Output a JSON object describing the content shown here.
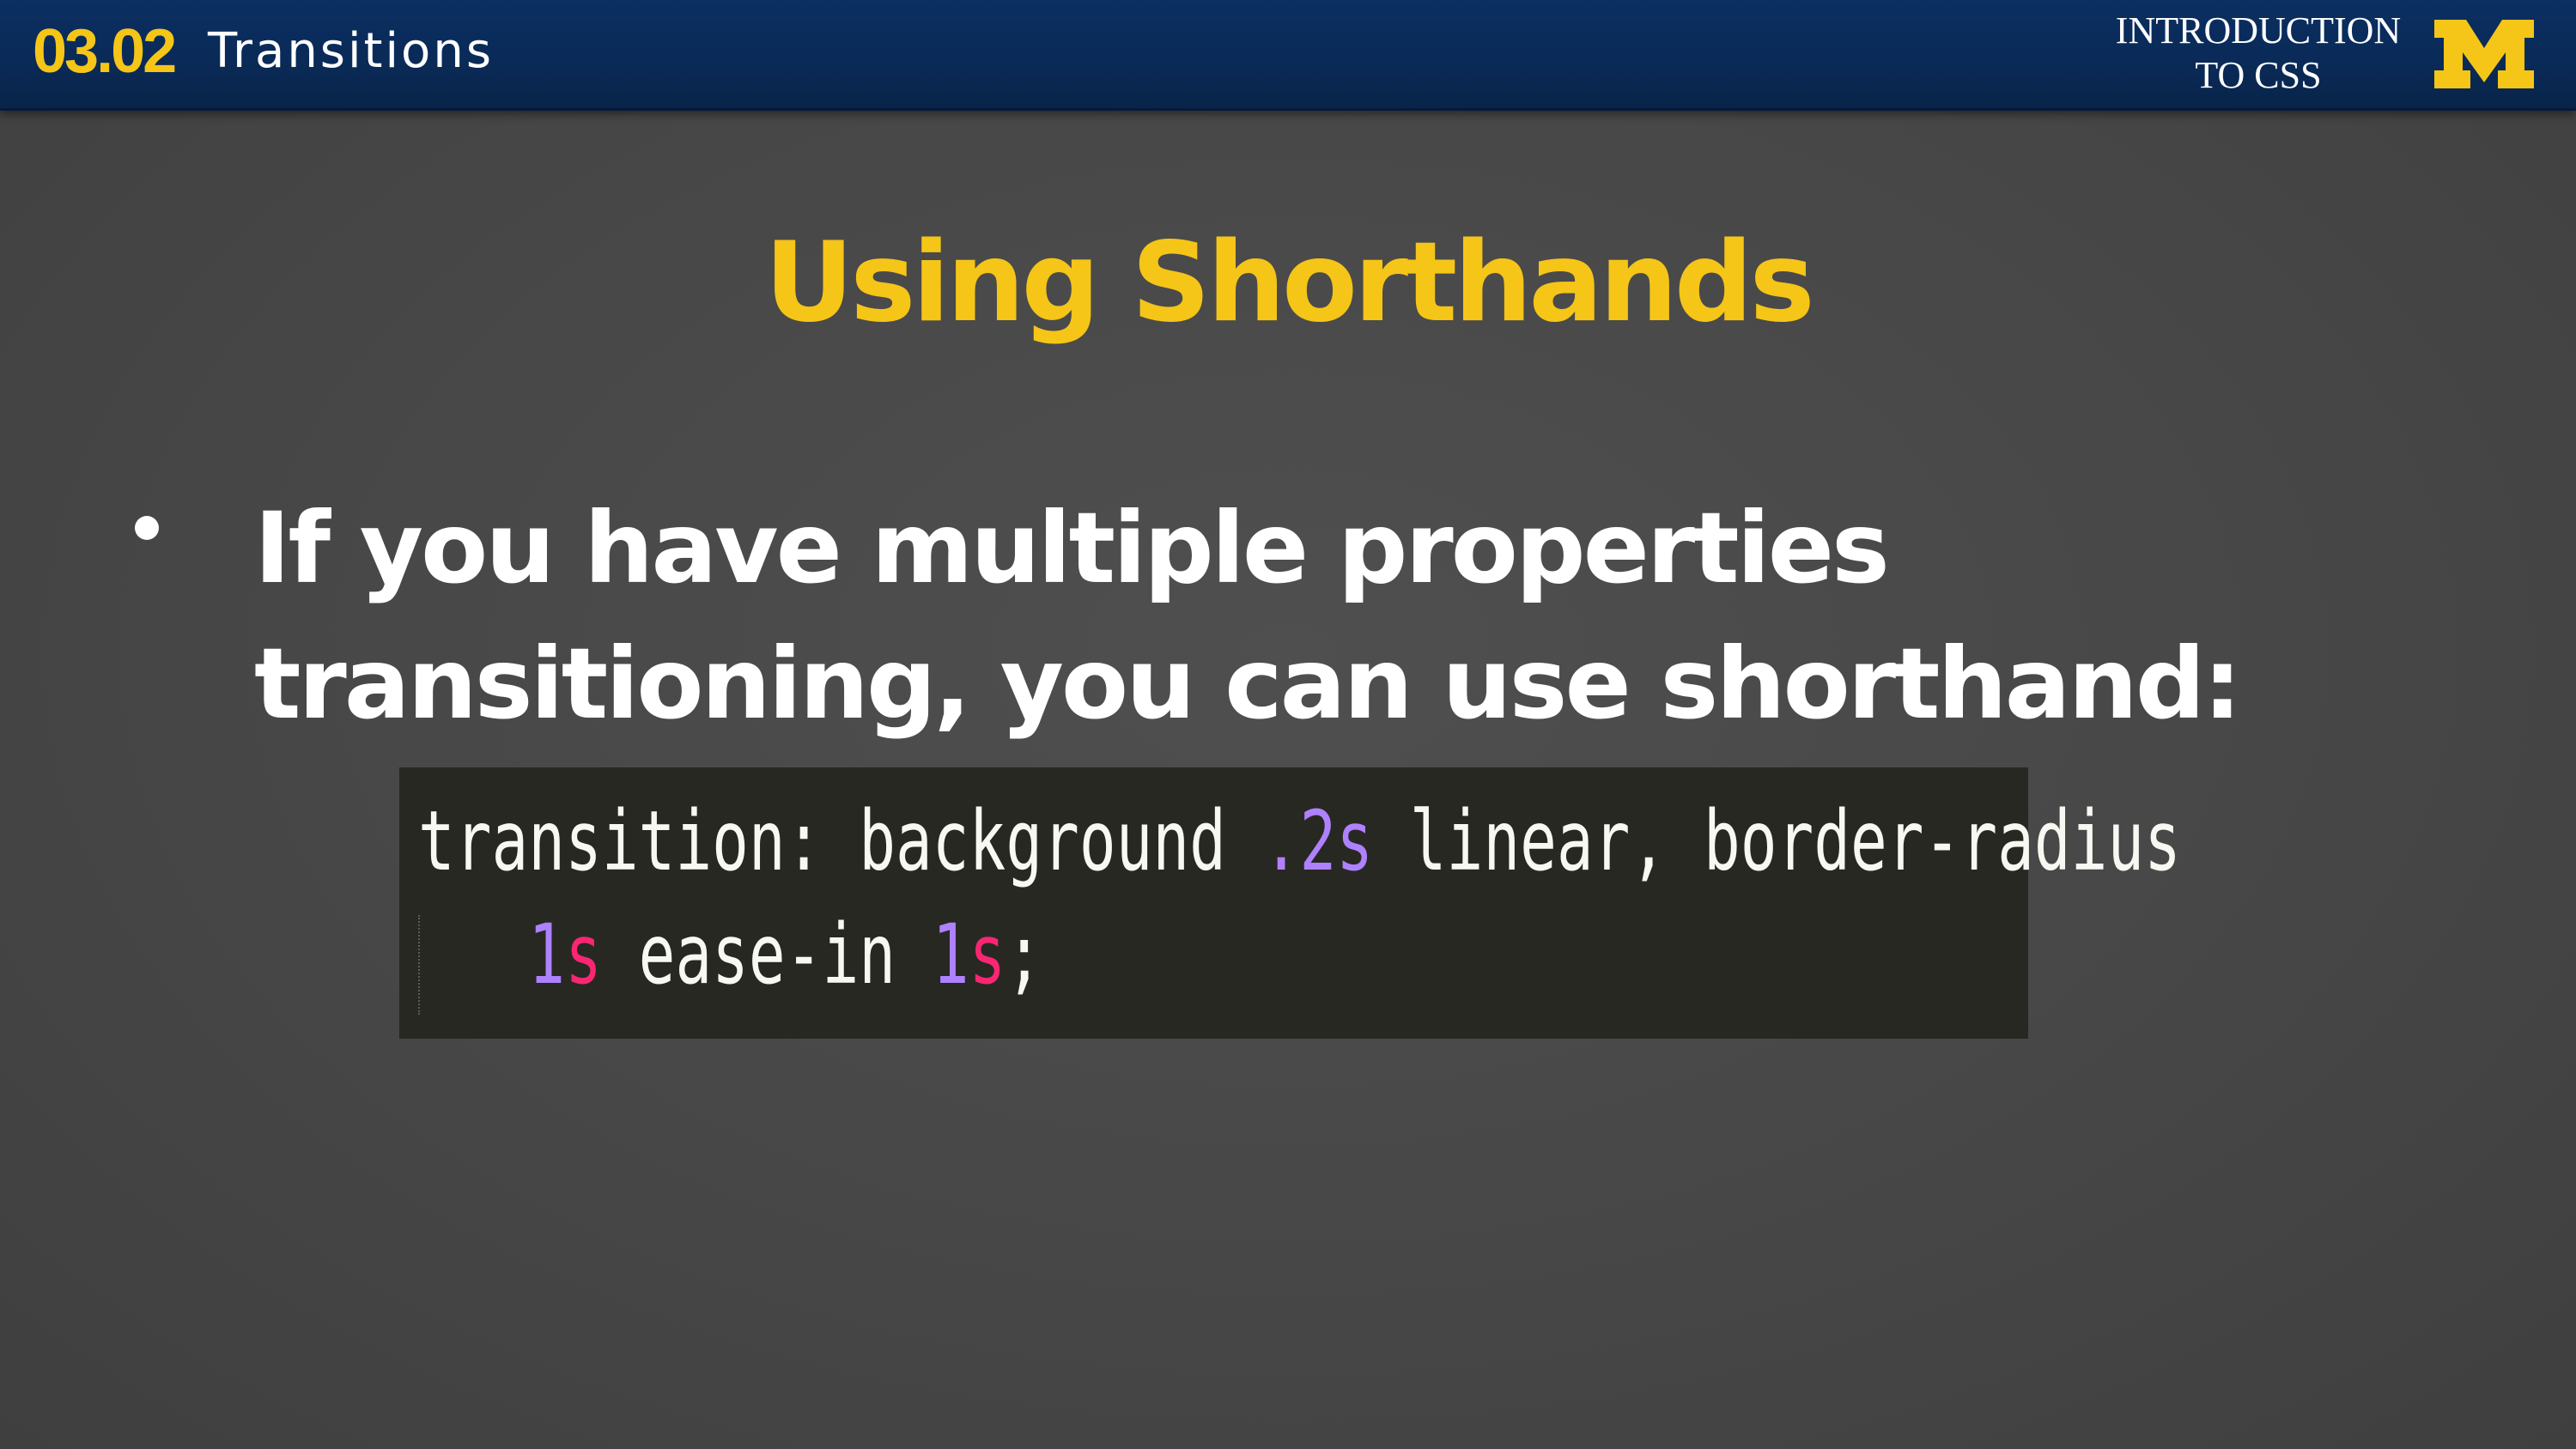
{
  "header": {
    "lesson_number": "03.02",
    "lesson_title": "Transitions",
    "course_name": "INTRODUCTION\nTO CSS",
    "logo_icon": "university-block-m-logo-icon"
  },
  "slide": {
    "title": "Using Shorthands",
    "bullet": "If you have multiple properties transitioning, you can use shorthand:"
  },
  "code": {
    "line1": {
      "prop": "transition: background ",
      "val1_num": ".2",
      "val1_unit": "s",
      "rest": " linear, border-radius"
    },
    "line2": {
      "indent": "   ",
      "val2_num": "1",
      "val2_unit": "s",
      "mid": " ease-in ",
      "val3_num": "1",
      "val3_unit": "s",
      "end": ";"
    }
  },
  "colors": {
    "header_bg": "#0a2a57",
    "accent_maize": "#f5c518",
    "code_bg": "#272822",
    "code_number": "#ae81ff",
    "code_unit": "#f92672",
    "code_text": "#f8f8f2"
  }
}
